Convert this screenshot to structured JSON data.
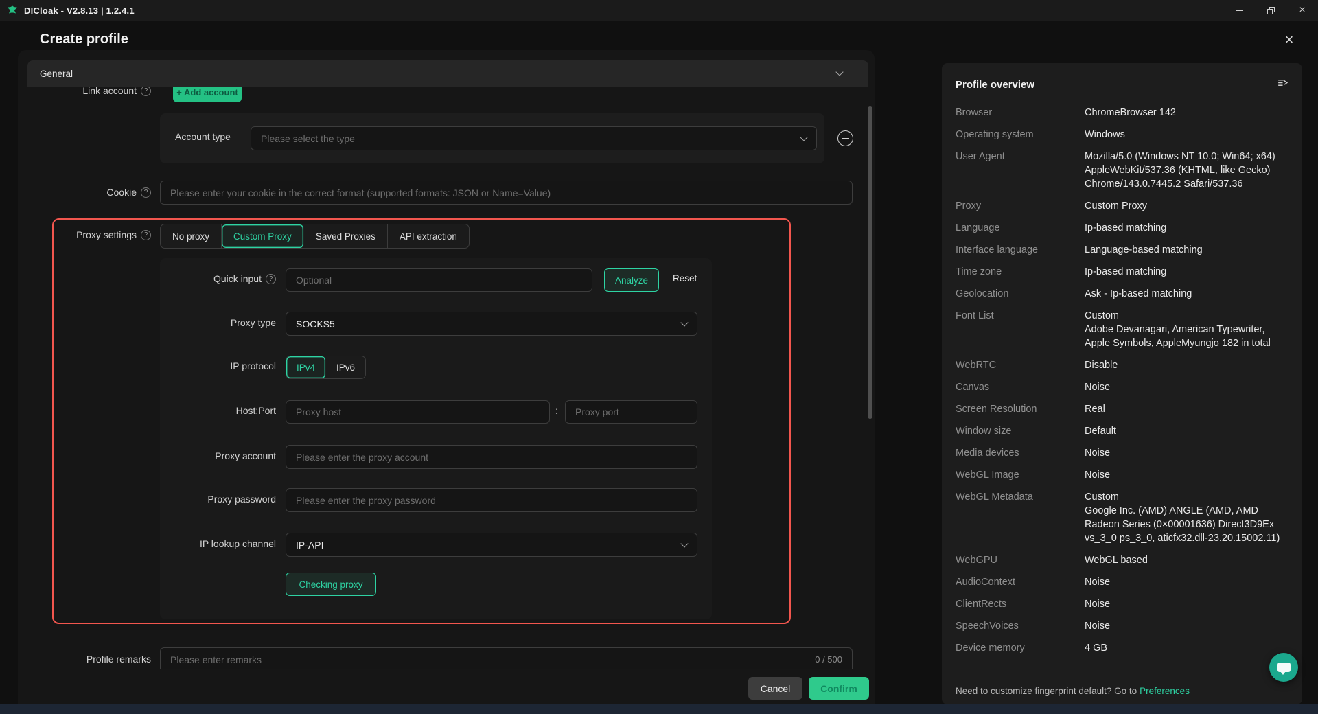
{
  "titlebar": {
    "title": "DICloak - V2.8.13 | 1.2.4.1"
  },
  "modal": {
    "title": "Create profile",
    "close_icon": "×"
  },
  "dialog": {
    "section": {
      "label": "General"
    },
    "link_account": {
      "label": "Link account",
      "help": "?",
      "add_button": "+ Add account"
    },
    "account": {
      "label": "Account type",
      "placeholder": "Please select the type"
    },
    "cookie": {
      "label": "Cookie",
      "help": "?",
      "placeholder": "Please enter your cookie in the correct format (supported formats: JSON or Name=Value)"
    },
    "proxy": {
      "label": "Proxy settings",
      "help": "?",
      "tabs": [
        "No proxy",
        "Custom Proxy",
        "Saved Proxies",
        "API extraction"
      ],
      "active_tab": "Custom Proxy",
      "quick_input": {
        "label": "Quick input",
        "help": "?",
        "placeholder": "Optional",
        "analyze": "Analyze",
        "reset": "Reset"
      },
      "proxy_type": {
        "label": "Proxy type",
        "value": "SOCKS5"
      },
      "ip_protocol": {
        "label": "IP protocol",
        "options": [
          "IPv4",
          "IPv6"
        ],
        "selected": "IPv4"
      },
      "host_port": {
        "label": "Host:Port",
        "host_placeholder": "Proxy host",
        "separator": ":",
        "port_placeholder": "Proxy port"
      },
      "account": {
        "label": "Proxy account",
        "placeholder": "Please enter the proxy account"
      },
      "password": {
        "label": "Proxy password",
        "placeholder": "Please enter the proxy password"
      },
      "lookup": {
        "label": "IP lookup channel",
        "value": "IP-API"
      },
      "check_button": "Checking proxy"
    },
    "remarks": {
      "label": "Profile remarks",
      "placeholder": "Please enter remarks",
      "counter": "0 / 500"
    },
    "footer": {
      "cancel": "Cancel",
      "confirm": "Confirm"
    }
  },
  "overview": {
    "title": "Profile overview",
    "rows": [
      {
        "label": "Browser",
        "value": "ChromeBrowser 142"
      },
      {
        "label": "Operating system",
        "value": "Windows"
      },
      {
        "label": "User Agent",
        "value": "Mozilla/5.0 (Windows NT 10.0; Win64; x64) AppleWebKit/537.36 (KHTML, like Gecko) Chrome/143.0.7445.2 Safari/537.36"
      },
      {
        "label": "Proxy",
        "value": "Custom Proxy"
      },
      {
        "label": "Language",
        "value": "Ip-based matching"
      },
      {
        "label": "Interface language",
        "value": "Language-based matching"
      },
      {
        "label": "Time zone",
        "value": "Ip-based matching"
      },
      {
        "label": "Geolocation",
        "value": "Ask - Ip-based matching"
      },
      {
        "label": "Font List",
        "value": "Custom\nAdobe Devanagari, American Typewriter, Apple Symbols, AppleMyungjo 182 in total"
      },
      {
        "label": "WebRTC",
        "value": "Disable"
      },
      {
        "label": "Canvas",
        "value": "Noise"
      },
      {
        "label": "Screen Resolution",
        "value": "Real"
      },
      {
        "label": "Window size",
        "value": "Default"
      },
      {
        "label": "Media devices",
        "value": "Noise"
      },
      {
        "label": "WebGL Image",
        "value": "Noise"
      },
      {
        "label": "WebGL Metadata",
        "value": "Custom\nGoogle Inc. (AMD) ANGLE (AMD, AMD Radeon Series (0×00001636) Direct3D9Ex vs_3_0 ps_3_0, aticfx32.dll-23.20.15002.11)"
      },
      {
        "label": "WebGPU",
        "value": "WebGL based"
      },
      {
        "label": "AudioContext",
        "value": "Noise"
      },
      {
        "label": "ClientRects",
        "value": "Noise"
      },
      {
        "label": "SpeechVoices",
        "value": "Noise"
      },
      {
        "label": "Device memory",
        "value": "4 GB"
      }
    ],
    "footer": {
      "text": "Need to customize fingerprint default? Go to",
      "link": "Preferences"
    }
  },
  "colors": {
    "accent": "#2ed3a3",
    "highlight_border": "#f2564e",
    "confirm_bg": "#2fca8c",
    "add_account_bg": "#24c184"
  }
}
